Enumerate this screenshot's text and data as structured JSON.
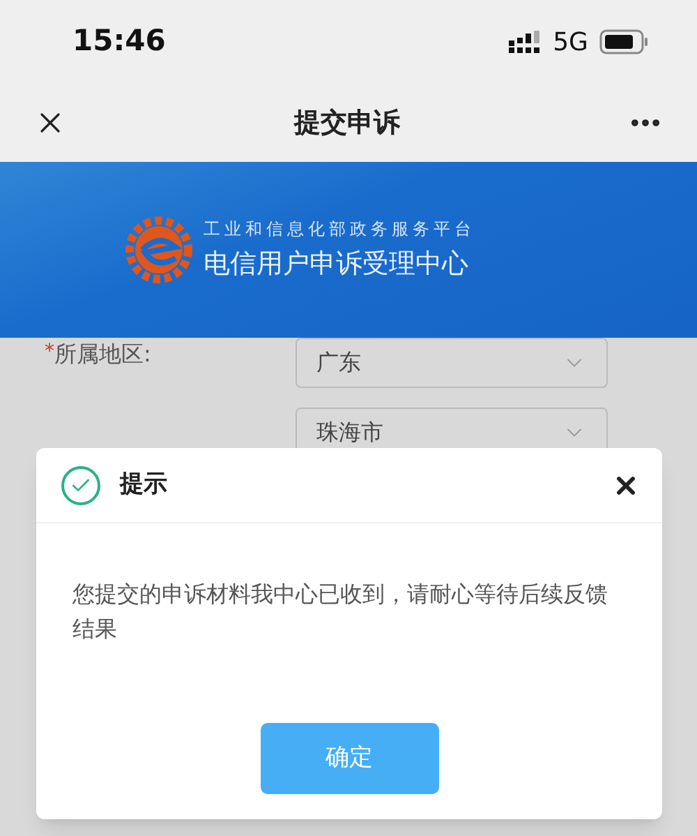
{
  "status_bar": {
    "time": "15:46",
    "network": "5G"
  },
  "nav": {
    "title": "提交申诉"
  },
  "banner": {
    "subtitle": "工业和信息化部政务服务平台",
    "title": "电信用户申诉受理中心"
  },
  "form": {
    "label": "所属地区:",
    "required_mark": "*",
    "selects": [
      {
        "value": "广东"
      },
      {
        "value": "珠海市"
      }
    ]
  },
  "dialog": {
    "title": "提示",
    "message": "您提交的申诉材料我中心已收到，请耐心等待后续反馈结果",
    "button": "确定"
  }
}
